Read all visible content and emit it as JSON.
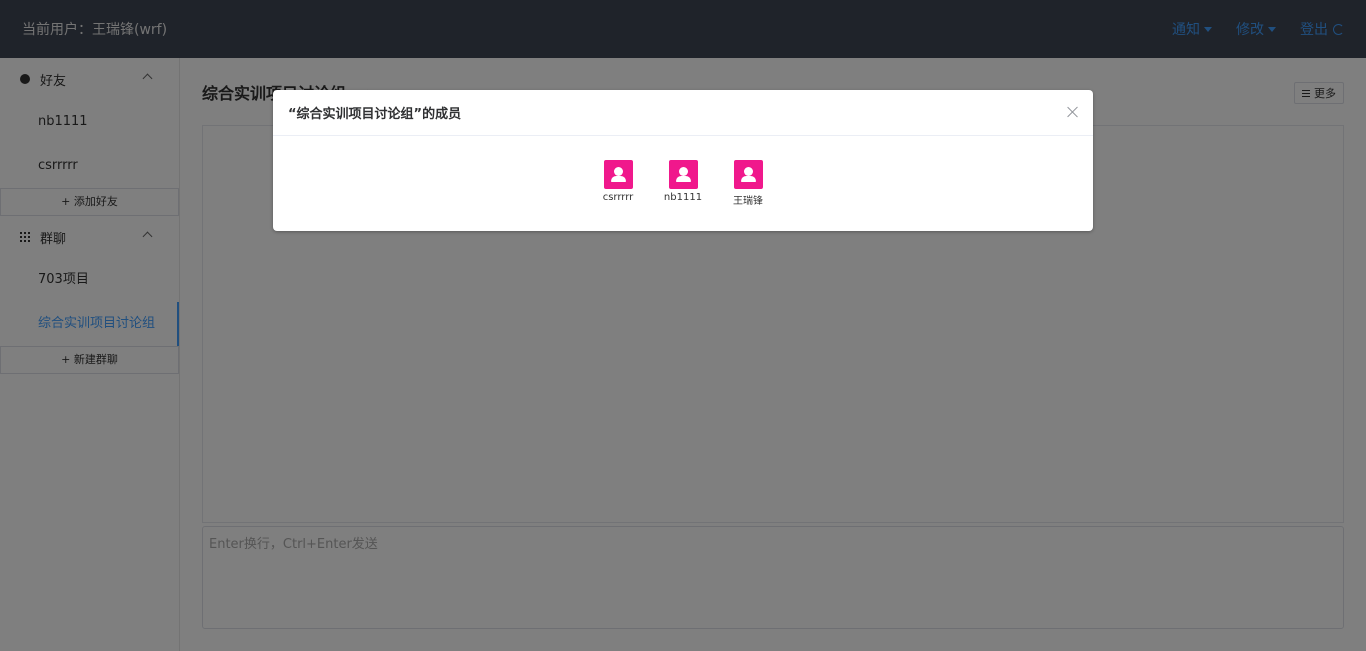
{
  "header": {
    "current_user": "当前用户：王瑞锋(wrf)",
    "notify_label": "通知",
    "modify_label": "修改",
    "logout_label": "登出"
  },
  "sidebar": {
    "friends_label": "好友",
    "friends": [
      "nb1111",
      "csrrrrr"
    ],
    "add_friend_label": "+ 添加好友",
    "groups_label": "群聊",
    "groups": [
      "703项目",
      "综合实训项目讨论组"
    ],
    "active_group": "综合实训项目讨论组",
    "new_group_label": "+ 新建群聊"
  },
  "main": {
    "chat_title": "综合实训项目讨论组",
    "more_label": "更多",
    "input_placeholder": "Enter换行，Ctrl+Enter发送"
  },
  "dialog": {
    "title": "“综合实训项目讨论组”的成员",
    "members": [
      {
        "name": "csrrrrr"
      },
      {
        "name": "nb1111"
      },
      {
        "name": "王瑞锋"
      }
    ]
  },
  "colors": {
    "header_bg": "#3f4654",
    "accent": "#409eff",
    "avatar": "#f0188c"
  }
}
